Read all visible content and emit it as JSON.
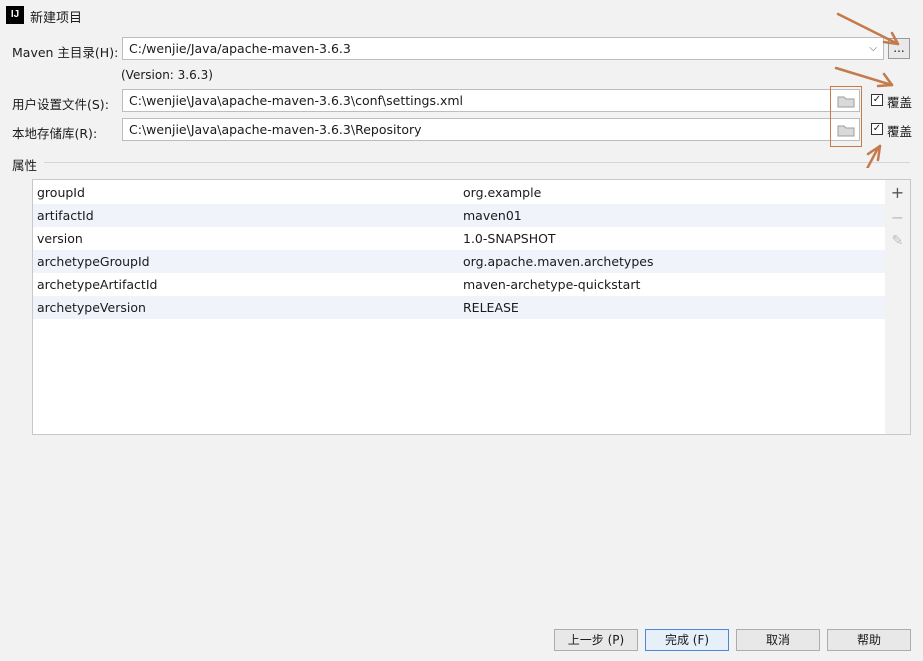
{
  "window": {
    "title": "新建项目",
    "icon_text": "IJ"
  },
  "maven_home": {
    "label": "Maven 主目录(H):",
    "value": "C:/wenjie/Java/apache-maven-3.6.3",
    "browse_label": "...",
    "version_note": "(Version: 3.6.3)"
  },
  "settings_file": {
    "label": "用户设置文件(S):",
    "value": "C:\\wenjie\\Java\\apache-maven-3.6.3\\conf\\settings.xml",
    "override_label": "覆盖",
    "override_checked": true
  },
  "local_repo": {
    "label": "本地存储库(R):",
    "value": "C:\\wenjie\\Java\\apache-maven-3.6.3\\Repository",
    "override_label": "覆盖",
    "override_checked": true
  },
  "properties": {
    "section_title": "属性",
    "rows": [
      {
        "key": "groupId",
        "value": "org.example"
      },
      {
        "key": "artifactId",
        "value": "maven01"
      },
      {
        "key": "version",
        "value": "1.0-SNAPSHOT"
      },
      {
        "key": "archetypeGroupId",
        "value": "org.apache.maven.archetypes"
      },
      {
        "key": "archetypeArtifactId",
        "value": "maven-archetype-quickstart"
      },
      {
        "key": "archetypeVersion",
        "value": "RELEASE"
      }
    ],
    "toolbar": {
      "add": "+",
      "remove": "−",
      "edit": "✎"
    }
  },
  "buttons": {
    "prev": "上一步 (P)",
    "finish": "完成 (F)",
    "cancel": "取消",
    "help": "帮助"
  },
  "colors": {
    "annotation": "#c47a4a",
    "accent": "#4a87d6"
  }
}
